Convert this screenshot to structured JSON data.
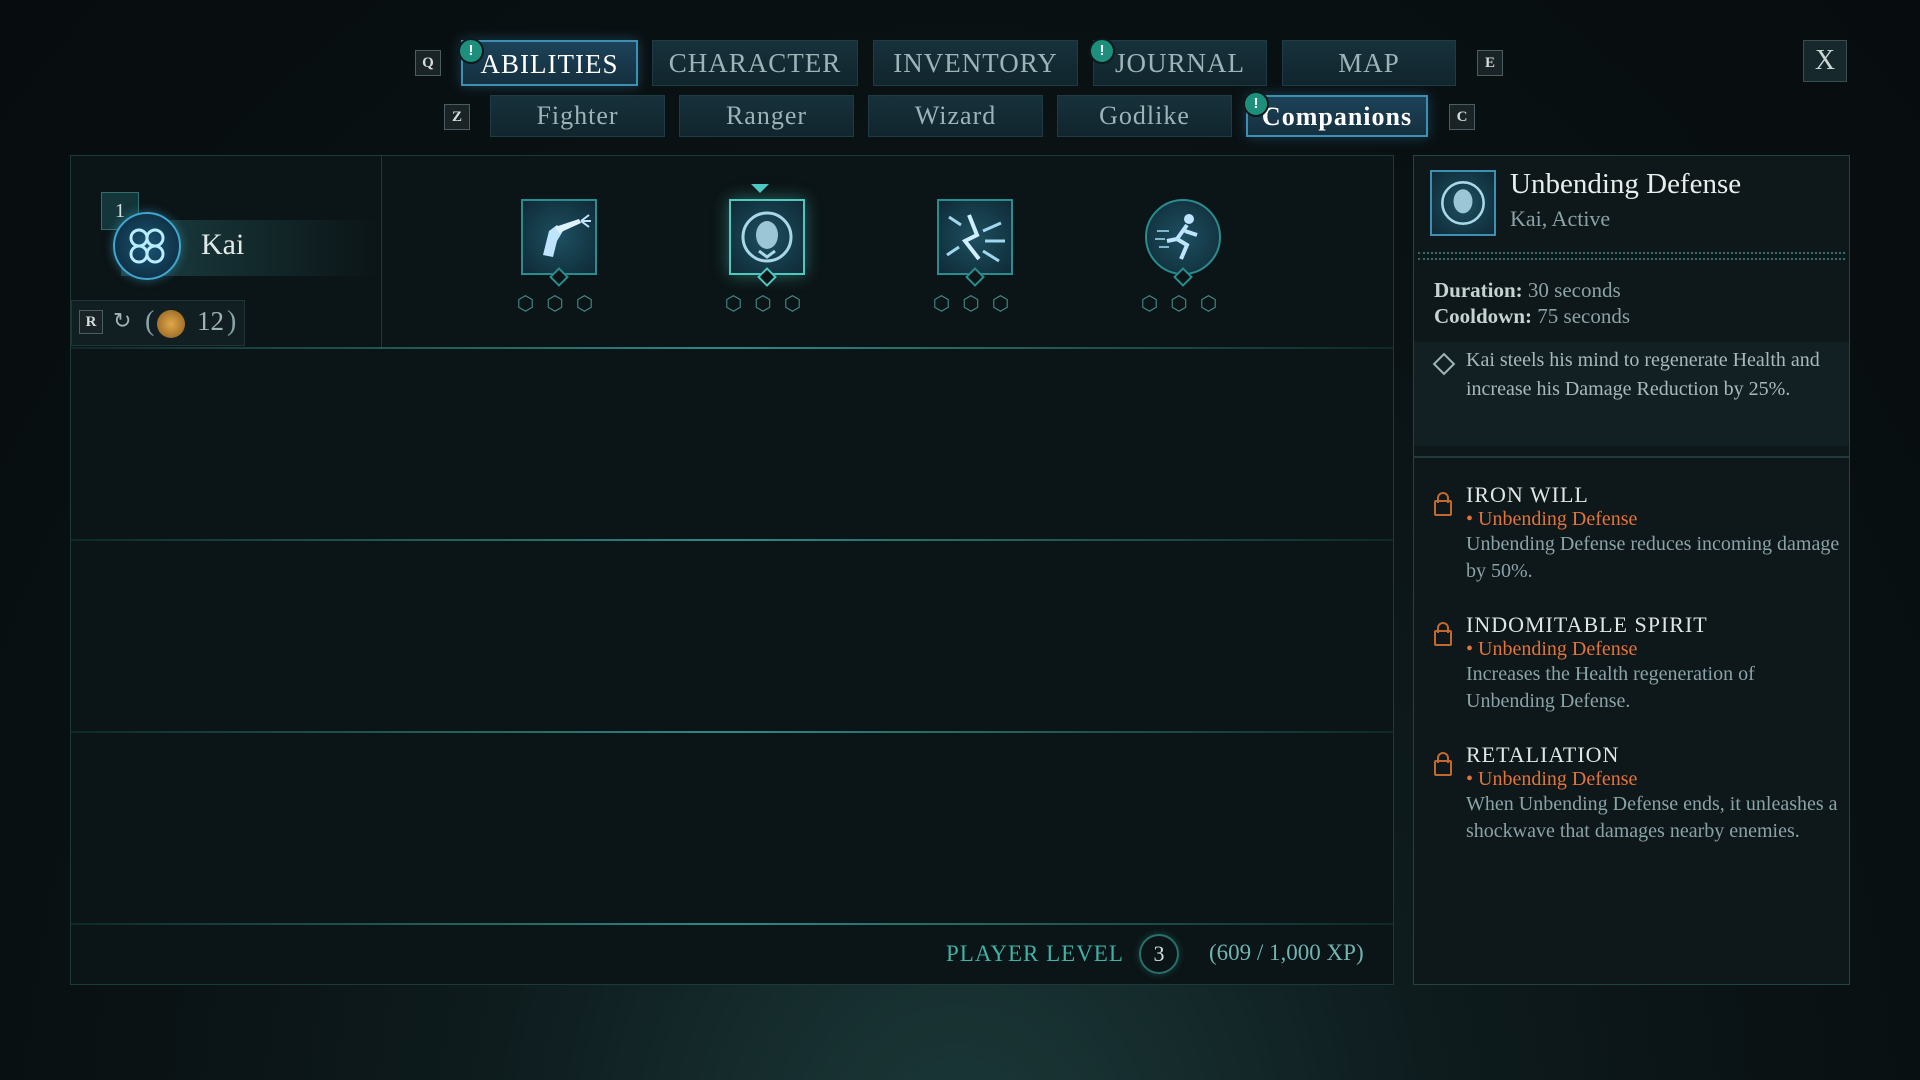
{
  "top_nav": {
    "prev_key": "Q",
    "next_key": "E",
    "tabs": [
      {
        "label": "ABILITIES",
        "active": true,
        "notify": "!"
      },
      {
        "label": "CHARACTER",
        "active": false
      },
      {
        "label": "INVENTORY",
        "active": false
      },
      {
        "label": "JOURNAL",
        "active": false,
        "notify": "!"
      },
      {
        "label": "MAP",
        "active": false
      }
    ],
    "close_label": "X"
  },
  "sub_nav": {
    "prev_key": "Z",
    "next_key": "C",
    "tabs": [
      {
        "label": "Fighter",
        "active": false
      },
      {
        "label": "Ranger",
        "active": false
      },
      {
        "label": "Wizard",
        "active": false
      },
      {
        "label": "Godlike",
        "active": false
      },
      {
        "label": "Companions",
        "active": true,
        "notify": "!"
      }
    ]
  },
  "companion": {
    "name": "Kai",
    "slot_number": "1",
    "reset_key": "R",
    "points_open": "(",
    "points": "12",
    "points_close": ")"
  },
  "abilities": [
    {
      "icon": "shotgun-blast-icon",
      "shape": "square",
      "selected": false
    },
    {
      "icon": "unbending-defense-icon",
      "shape": "square",
      "selected": true
    },
    {
      "icon": "shockwave-icon",
      "shape": "square",
      "selected": false
    },
    {
      "icon": "dash-icon",
      "shape": "round",
      "selected": false
    }
  ],
  "player_level": {
    "label": "PLAYER LEVEL",
    "level": "3",
    "xp": "(609 / 1,000 XP)"
  },
  "detail": {
    "title": "Unbending Defense",
    "subtitle": "Kai, Active",
    "duration_label": "Duration:",
    "duration_value": "30 seconds",
    "cooldown_label": "Cooldown:",
    "cooldown_value": "75 seconds",
    "description": "Kai steels his mind to regenerate Health and increase his Damage Reduction by 25%.",
    "perks": [
      {
        "name": "IRON WILL",
        "tag": "• Unbending Defense",
        "desc": "Unbending Defense reduces incoming damage by 50%."
      },
      {
        "name": "INDOMITABLE SPIRIT",
        "tag": "• Unbending Defense",
        "desc": "Increases the Health regeneration of Unbending Defense."
      },
      {
        "name": "RETALIATION",
        "tag": "• Unbending Defense",
        "desc": "When Unbending Defense ends, it unleashes a shockwave that damages nearby enemies."
      }
    ]
  },
  "colors": {
    "accent": "#3f8fb5",
    "teal": "#2a8c8c",
    "perk_tag": "#e2733b"
  }
}
